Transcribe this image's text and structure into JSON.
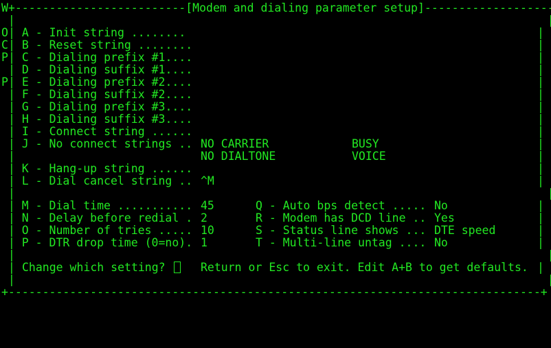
{
  "window": {
    "top_border": "W+-------------------------[Modem and dialing parameter setup]--------------------+",
    "bottom_border": "+------------------------------------------------------------------------------+",
    "blank_line": " |                                                                              |"
  },
  "settings": [
    {
      "prefix": "O",
      "label": "| A - Init string ........",
      "value": "",
      "right": "|"
    },
    {
      "prefix": "C",
      "label": "| B - Reset string ........",
      "value": "",
      "right": "|"
    },
    {
      "prefix": "P",
      "label": "| C - Dialing prefix #1....",
      "value": "",
      "right": "|"
    },
    {
      "prefix": "",
      "label": "| D - Dialing suffix #1....",
      "value": "",
      "right": "|"
    },
    {
      "prefix": "P",
      "label": "| E - Dialing prefix #2....",
      "value": "",
      "right": "|"
    },
    {
      "prefix": "",
      "label": "| F - Dialing suffix #2....",
      "value": "",
      "right": "|"
    },
    {
      "prefix": "",
      "label": "| G - Dialing prefix #3....",
      "value": "",
      "right": "|"
    },
    {
      "prefix": "",
      "label": "| H - Dialing suffix #3....",
      "value": "",
      "right": "|"
    },
    {
      "prefix": "",
      "label": "| I - Connect string ......",
      "value": "",
      "right": "|"
    }
  ],
  "no_connect": {
    "label": " | J - No connect strings ..",
    "values": [
      "NO CARRIER",
      "BUSY",
      "NO DIALTONE",
      "VOICE"
    ]
  },
  "hangup": {
    "label": " | K - Hang-up string ......",
    "value": ""
  },
  "dial_cancel": {
    "label": " | L - Dial cancel string ..",
    "value": "^M"
  },
  "params": [
    {
      "label": " | M - Dial time ...........",
      "value": "45",
      "right_label": "Q - Auto bps detect .....",
      "right_value": "No"
    },
    {
      "label": " | N - Delay before redial .",
      "value": "2",
      "right_label": "R - Modem has DCD line ..",
      "right_value": "Yes"
    },
    {
      "label": " | O - Number of tries .....",
      "value": "10",
      "right_label": "S - Status line shows ...",
      "right_value": "DTE speed"
    },
    {
      "label": " | P - DTR drop time (0=no).",
      "value": "1",
      "right_label": "T - Multi-line untag ....",
      "right_value": "No"
    }
  ],
  "prompt": {
    "question": "Change which setting?",
    "hint": "Return or Esc to exit. Edit A+B to get defaults."
  },
  "colors": {
    "foreground": "#22e822",
    "background": "#000000"
  }
}
